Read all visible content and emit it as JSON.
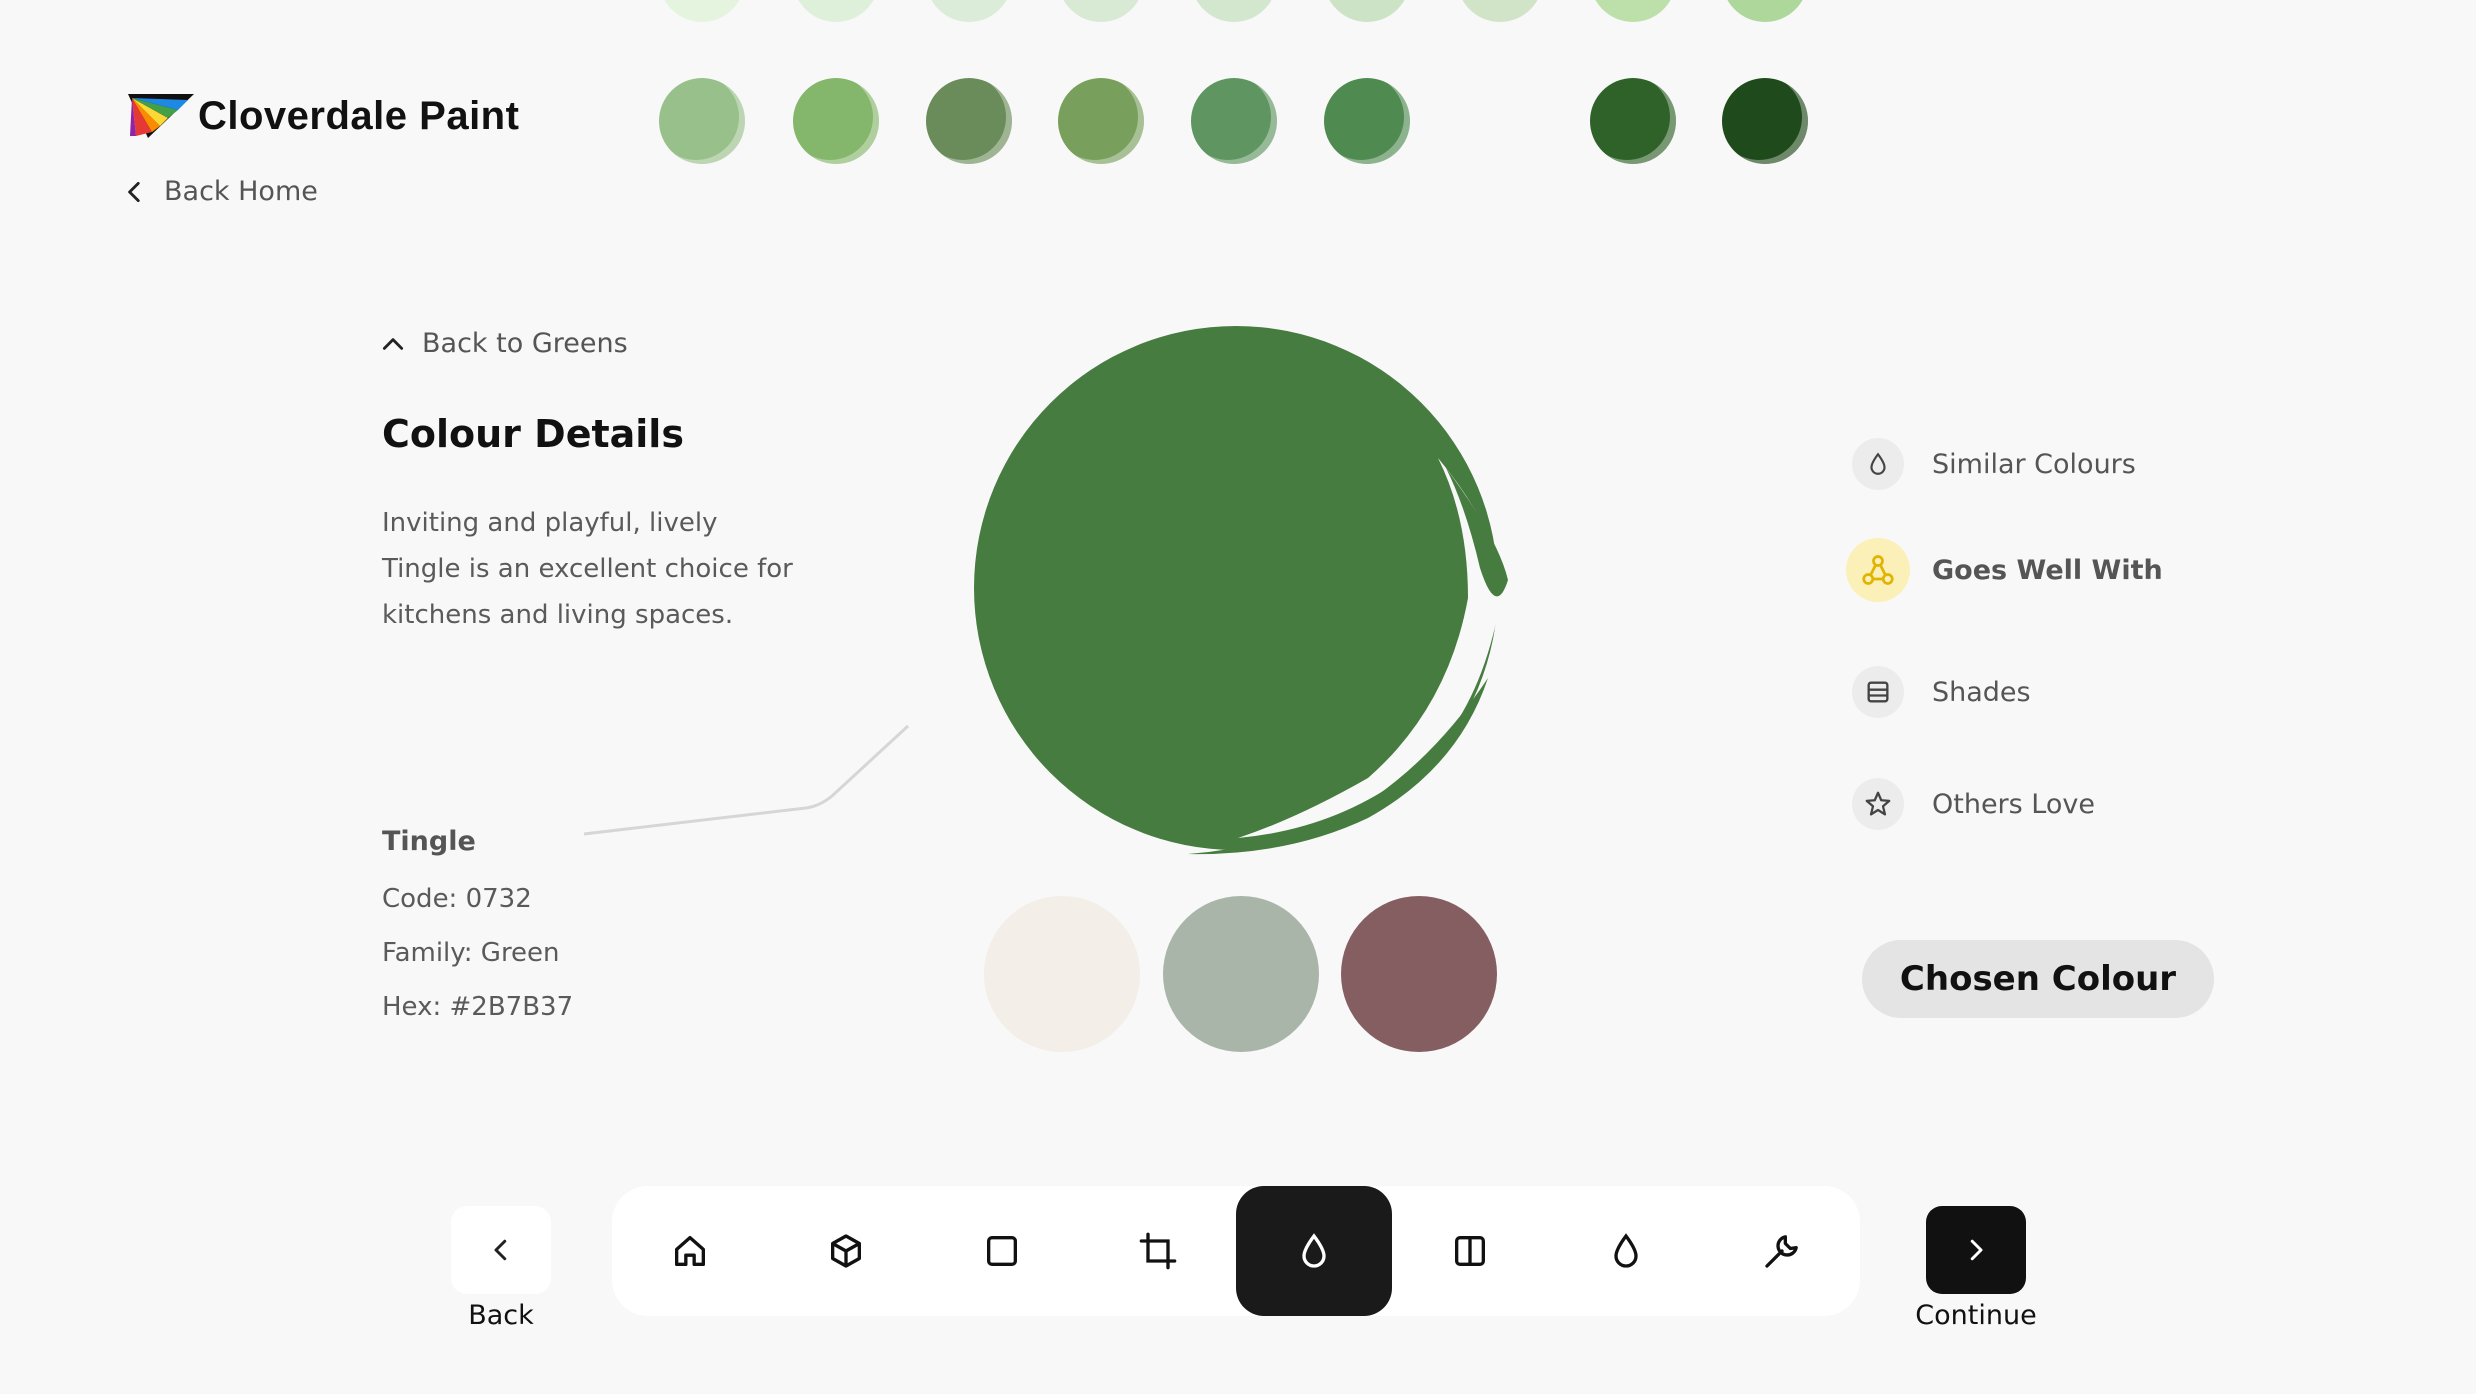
{
  "brand": {
    "name": "Cloverdale Paint"
  },
  "nav": {
    "back_home": "Back Home",
    "back_to_family": "Back to Greens"
  },
  "swatches_top_row_faded": [
    "#dff3d6",
    "#d7edd0",
    "#d2e8cd",
    "#cde6c8",
    "#c6e2c0",
    "#bfdcb4",
    "#c6ddb8",
    "#a9d890",
    "#95cc7c"
  ],
  "swatches_row": [
    "#98c08a",
    "#84b66c",
    "#6a8c5a",
    "#789f5c",
    "#5f9561",
    "#4f8a50",
    "#2f6229",
    "#1f4a1b"
  ],
  "details": {
    "heading": "Colour Details",
    "description": "Inviting and playful, lively Tingle is an excellent choice for kitchens and living spaces.",
    "name": "Tingle",
    "code": "Code: 0732",
    "family": "Family: Green",
    "hex": "Hex: #2B7B37"
  },
  "main_colour": "#467c3f",
  "pairings": [
    "#f3eee7",
    "#a9b5a9",
    "#845e60"
  ],
  "menu": {
    "items": [
      {
        "label": "Similar Colours",
        "icon": "drop-icon"
      },
      {
        "label": "Goes Well With",
        "icon": "connection-icon"
      },
      {
        "label": "Shades",
        "icon": "layers-icon"
      },
      {
        "label": "Others Love",
        "icon": "star-icon"
      }
    ],
    "active_index": 1
  },
  "chosen_button": "Chosen Colour",
  "toolbar": {
    "back_label": "Back",
    "continue_label": "Continue",
    "tools": [
      "home-icon",
      "cube-icon",
      "square-icon",
      "crop-icon",
      "drop-icon",
      "split-icon",
      "drop-icon",
      "wrench-icon"
    ],
    "active_index": 4
  }
}
